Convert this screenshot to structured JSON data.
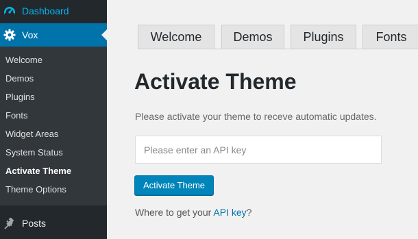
{
  "sidebar": {
    "dashboard": {
      "label": "Dashboard",
      "icon": "dashboard-icon"
    },
    "vox": {
      "label": "Vox",
      "icon": "gear-icon"
    },
    "submenu": [
      {
        "label": "Welcome"
      },
      {
        "label": "Demos"
      },
      {
        "label": "Plugins"
      },
      {
        "label": "Fonts"
      },
      {
        "label": "Widget Areas"
      },
      {
        "label": "System Status"
      },
      {
        "label": "Activate Theme",
        "current": true
      },
      {
        "label": "Theme Options"
      }
    ],
    "posts": {
      "label": "Posts",
      "icon": "pin-icon"
    }
  },
  "tabs": [
    {
      "label": "Welcome"
    },
    {
      "label": "Demos"
    },
    {
      "label": "Plugins"
    },
    {
      "label": "Fonts"
    }
  ],
  "main": {
    "title": "Activate Theme",
    "description": "Please activate your theme to receve automatic updates.",
    "api_input": {
      "placeholder": "Please enter an API key",
      "value": ""
    },
    "activate_button": "Activate Theme",
    "where_text": "Where to get your ",
    "api_key_link": "API key",
    "where_suffix": "?"
  },
  "colors": {
    "sidebar_bg": "#23282d",
    "submenu_bg": "#32373c",
    "accent": "#0073aa",
    "button": "#0085ba",
    "link": "#0073aa",
    "dashboard_label": "#00b9eb"
  }
}
